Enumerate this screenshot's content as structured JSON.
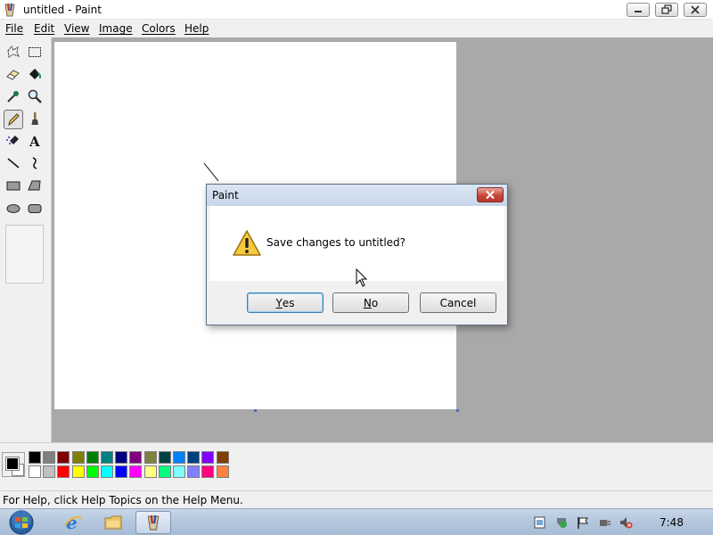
{
  "window": {
    "title": "untitled - Paint"
  },
  "menu": {
    "items": [
      "File",
      "Edit",
      "View",
      "Image",
      "Colors",
      "Help"
    ]
  },
  "toolbox": {
    "tools": [
      "free-form-select-icon",
      "select-icon",
      "eraser-icon",
      "fill-icon",
      "pick-color-icon",
      "magnifier-icon",
      "pencil-icon",
      "brush-icon",
      "airbrush-icon",
      "text-icon",
      "line-icon",
      "curve-icon",
      "rectangle-icon",
      "polygon-icon",
      "ellipse-icon",
      "rounded-rectangle-icon"
    ],
    "selected_tool": "pencil-icon"
  },
  "palette": {
    "foreground": "#000000",
    "background": "#ffffff",
    "top_row": [
      "#000000",
      "#808080",
      "#800000",
      "#808000",
      "#008000",
      "#008080",
      "#000080",
      "#800080",
      "#808040",
      "#004040",
      "#0080ff",
      "#004080",
      "#8000ff",
      "#804000"
    ],
    "bottom_row": [
      "#ffffff",
      "#c0c0c0",
      "#ff0000",
      "#ffff00",
      "#00ff00",
      "#00ffff",
      "#0000ff",
      "#ff00ff",
      "#ffff80",
      "#00ff80",
      "#80ffff",
      "#8080ff",
      "#ff0080",
      "#ff8040"
    ]
  },
  "status": {
    "text": "For Help, click Help Topics on the Help Menu."
  },
  "dialog": {
    "title": "Paint",
    "message": "Save changes to untitled?",
    "yes_first": "Y",
    "yes_rest": "es",
    "no_first": "N",
    "no_rest": "o",
    "cancel": "Cancel",
    "icon": "warning-icon"
  },
  "taskbar": {
    "clock": "7:48",
    "pinned": [
      "internet-explorer-icon",
      "windows-explorer-icon",
      "paint-app-icon"
    ],
    "tray": [
      "action-center-icon",
      "network-icon",
      "flag-icon",
      "power-icon",
      "volume-muted-icon"
    ]
  }
}
